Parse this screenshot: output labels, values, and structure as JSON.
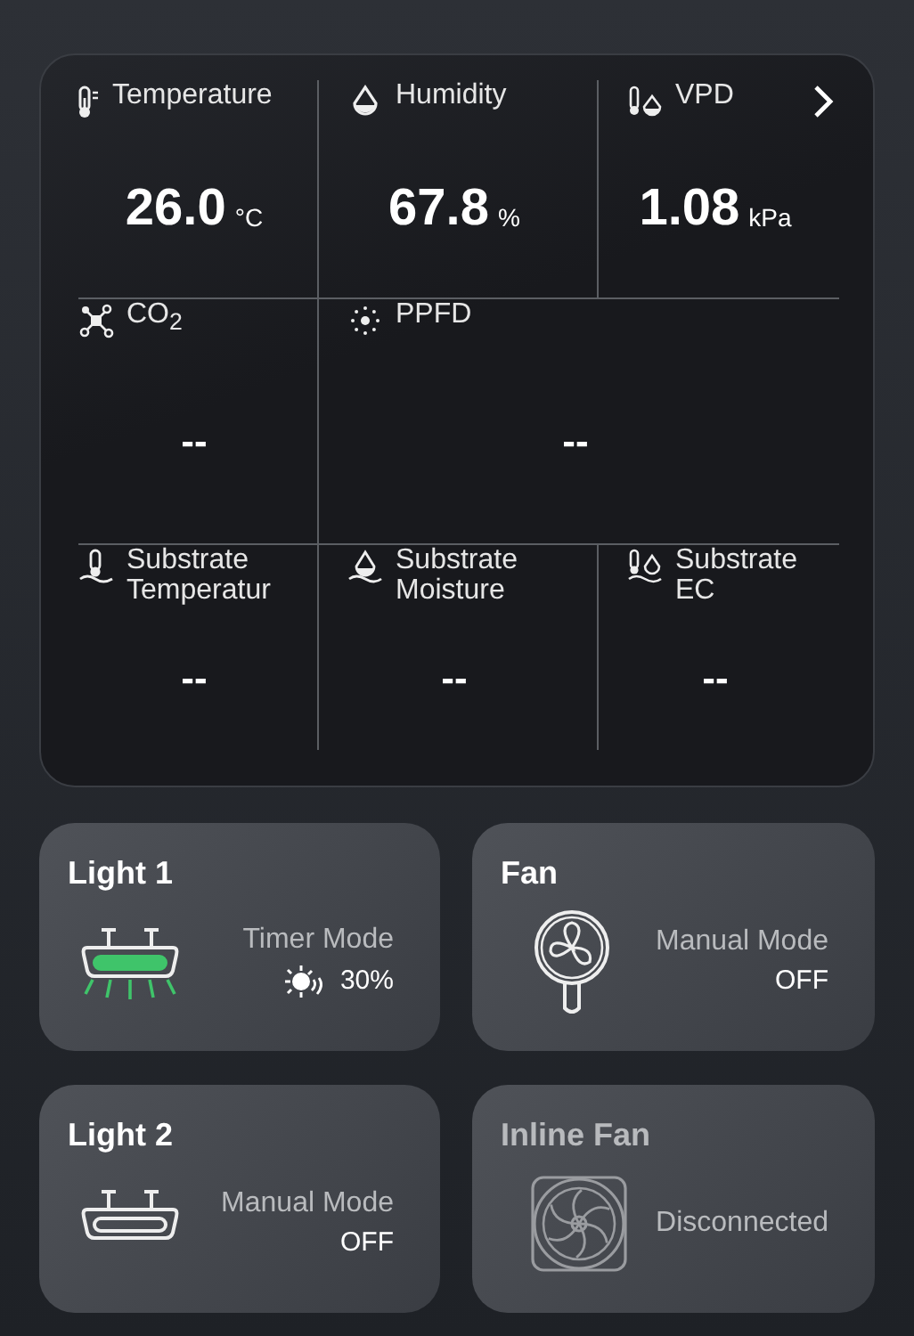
{
  "sensors": [
    {
      "kind": "temperature",
      "label": "Temperature",
      "value": "26.0",
      "unit": "°C"
    },
    {
      "kind": "humidity",
      "label": "Humidity",
      "value": "67.8",
      "unit": "%"
    },
    {
      "kind": "vpd",
      "label": "VPD",
      "value": "1.08",
      "unit": "kPa"
    },
    {
      "kind": "co2",
      "label": "CO$_{2}$",
      "value": "--"
    },
    {
      "kind": "ppfd",
      "label": "PPFD",
      "value": "--"
    },
    {
      "kind": "substrate_temperature",
      "label": "Substrate Temperatur",
      "value": "--"
    },
    {
      "kind": "substrate_moisture",
      "label": "Substrate Moisture",
      "value": "--"
    },
    {
      "kind": "substrate_ec",
      "label": "Substrate EC",
      "value": "--"
    }
  ],
  "devices": [
    {
      "kind": "light",
      "name": "Light 1",
      "connected": true,
      "on": true,
      "mode": "Timer Mode",
      "brightness": "30%"
    },
    {
      "kind": "fan",
      "name": "Fan",
      "connected": true,
      "on": false,
      "mode": "Manual Mode",
      "status": "OFF"
    },
    {
      "kind": "light",
      "name": "Light 2",
      "connected": true,
      "on": false,
      "mode": "Manual Mode",
      "status": "OFF"
    },
    {
      "kind": "inline_fan",
      "name": "Inline Fan",
      "connected": false,
      "mode": "Disconnected"
    }
  ]
}
